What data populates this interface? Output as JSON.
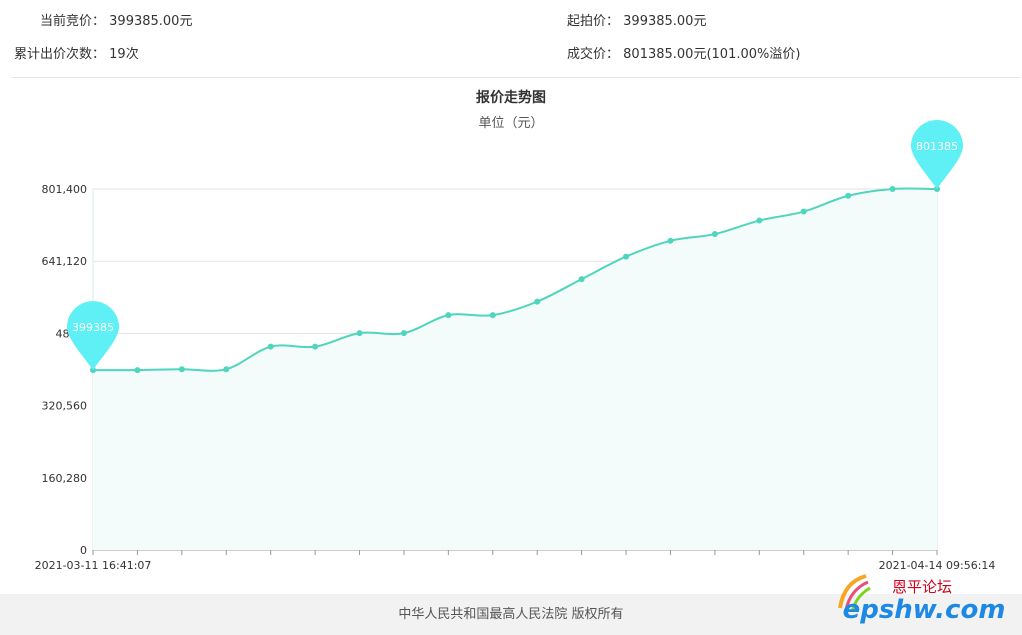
{
  "info": {
    "current_label": "当前竞价：",
    "current_value": "399385.00元",
    "start_label": "起拍价：",
    "start_value": "399385.00元",
    "count_label": "累计出价次数：",
    "count_value": "19次",
    "deal_label": "成交价：",
    "deal_value": "801385.00元(101.00%溢价)"
  },
  "footer": {
    "text": "中华人民共和国最高人民法院 版权所有"
  },
  "watermark": {
    "brand": "epshw.com",
    "tagline": "恩平论坛"
  },
  "colors": {
    "line": "#4fd5bd",
    "fill": "#f3fbfb",
    "marker": "#5ff0f5"
  },
  "chart_data": {
    "type": "line",
    "title": "报价走势图",
    "subtitle": "单位（元）",
    "ylim": [
      0,
      801400
    ],
    "yticks": [
      0,
      160280,
      320560,
      480840,
      641120,
      801400
    ],
    "ytick_labels": [
      "0",
      "160,280",
      "320,560",
      "480,8",
      "641,120",
      "801,400"
    ],
    "x_first_label": "2021-03-11 16:41:07",
    "x_last_label": "2021-04-14 09:56:14",
    "values": [
      399385,
      399385,
      401385,
      401385,
      451385,
      451385,
      481385,
      481385,
      521385,
      521385,
      551385,
      601385,
      651385,
      686385,
      701385,
      731385,
      751385,
      786385,
      801385,
      801385
    ],
    "markers": [
      {
        "index": 0,
        "label": "399385"
      },
      {
        "index": 19,
        "label": "801385"
      }
    ],
    "grid": true
  }
}
